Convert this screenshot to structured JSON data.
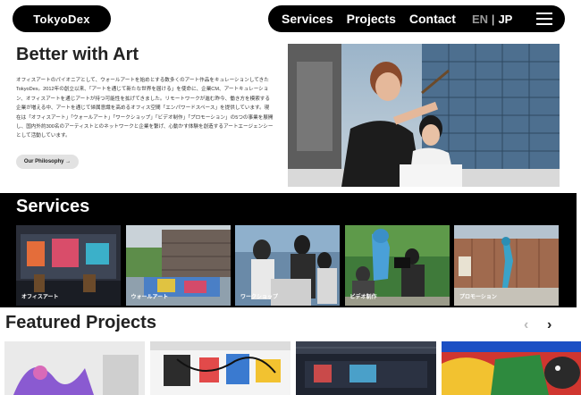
{
  "header": {
    "logo": "TokyoDex",
    "nav": [
      "Services",
      "Projects",
      "Contact"
    ],
    "lang_en": "EN",
    "lang_sep": "|",
    "lang_jp": "JP"
  },
  "hero": {
    "title": "Better with Art",
    "body": "オフィスアートのパイオニアとして、ウォールアートを始めとする数多くのアート作品をキュレーションしてきたTokyoDex。2012年の創立以来、「アートを通じて新たな世界を届ける」を使命に、企業CM、アートキュレーション、オフィスアートを通じアートが持つ可能性を拡げてきました。リモートワークが進む昨今、働き方を模索する企業が増える中、アートを通じて帰属意識を高めるオフィス空間「エンパワードスペース」を提供しています。現在は「オフィスアート」「ウォールアート」「ワークショップ」「ビデオ制作」「プロモーション」の5つの事業を展開し、国内外約300名のアーティストとのネットワークと企業を繋げ、心動かす体験を創造するアートエージェンシーとして活動しています。",
    "button": "Our Philosophy →"
  },
  "services": {
    "title": "Services",
    "cards": [
      "オフィスアート",
      "ウォールアート",
      "ワークショップ",
      "ビデオ制作",
      "プロモーション"
    ]
  },
  "featured": {
    "title": "Featured Projects",
    "prev": "‹",
    "next": "›"
  }
}
